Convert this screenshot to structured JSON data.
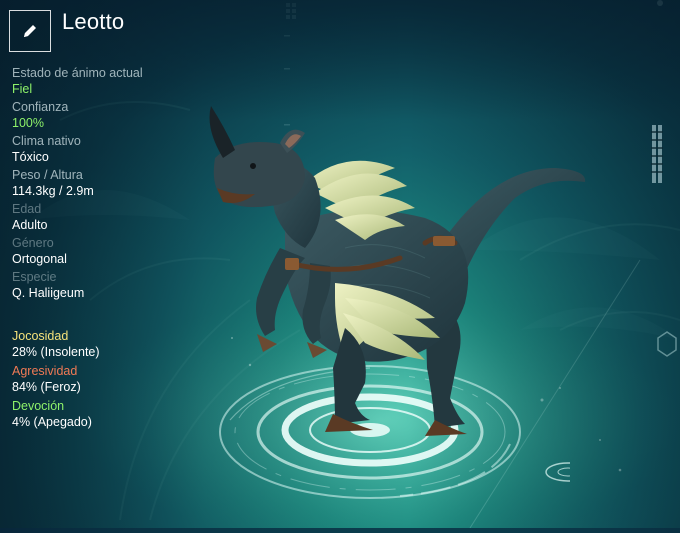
{
  "header": {
    "name": "Leotto",
    "edit_icon": "pencil-icon"
  },
  "stats": [
    {
      "label": "Estado de ánimo actual",
      "value": "Fiel",
      "value_color": "#8ef26a"
    },
    {
      "label": "Confianza",
      "value": "100%",
      "value_color": "#8ef26a"
    },
    {
      "label": "Clima nativo",
      "value": "Tóxico"
    },
    {
      "label": "Peso / Altura",
      "value": "114.3kg / 2.9m"
    },
    {
      "label": "Edad",
      "value": "Adulto"
    },
    {
      "label": "Género",
      "value": "Ortogonal"
    },
    {
      "label": "Especie",
      "value": "Q. Haliigeum"
    }
  ],
  "traits": [
    {
      "label": "Jocosidad",
      "label_color": "#f4e27a",
      "value": "28% (Insolente)"
    },
    {
      "label": "Agresividad",
      "label_color": "#f07a55",
      "value": "84% (Feroz)"
    },
    {
      "label": "Devoción",
      "label_color": "#8ef26a",
      "value": "4% (Apegado)"
    }
  ],
  "colors": {
    "background": "#12606a",
    "platform_glow": "#dff8f2",
    "creature_body": "#2f4a52",
    "creature_feathers": "#cfd8a6"
  }
}
